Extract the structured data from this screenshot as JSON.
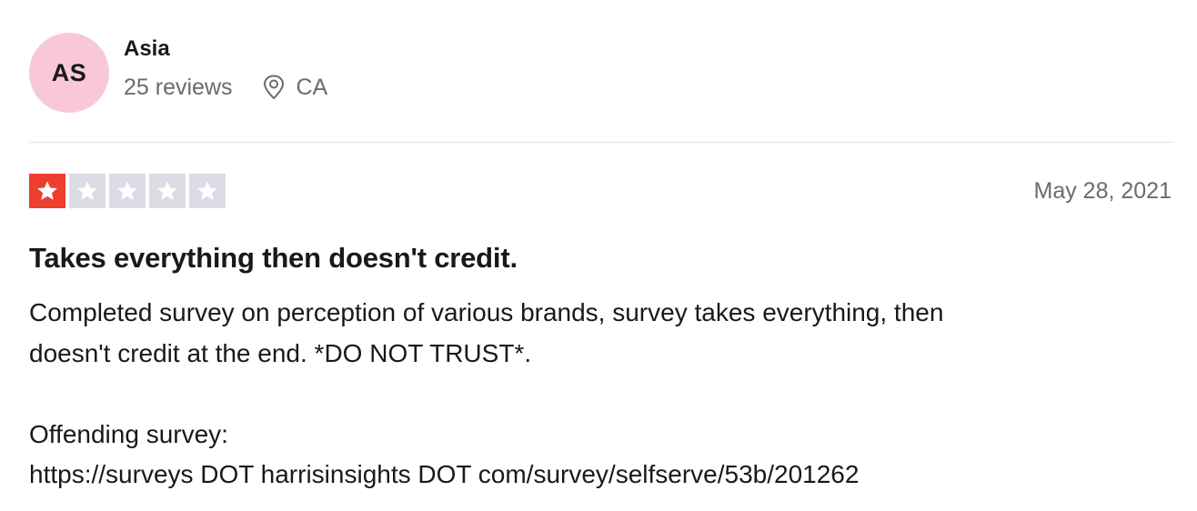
{
  "consumer": {
    "initials": "AS",
    "name": "Asia",
    "reviews_count": "25 reviews",
    "location": "CA",
    "location_icon": "map-pin-icon",
    "avatar_color": "#f8c8d8"
  },
  "review": {
    "rating": 1,
    "rating_max": 5,
    "rating_color": "#ee3e2d",
    "empty_star_color": "#dcdce6",
    "date": "May 28, 2021",
    "title": "Takes everything then doesn't credit.",
    "body_lines": [
      "Completed survey on perception of various brands, survey takes everything, then",
      "doesn't credit at the end. *DO NOT TRUST*."
    ],
    "body_label": "Offending survey:",
    "body_url": "https://surveys DOT harrisinsights DOT com/survey/selfserve/53b/201262"
  }
}
